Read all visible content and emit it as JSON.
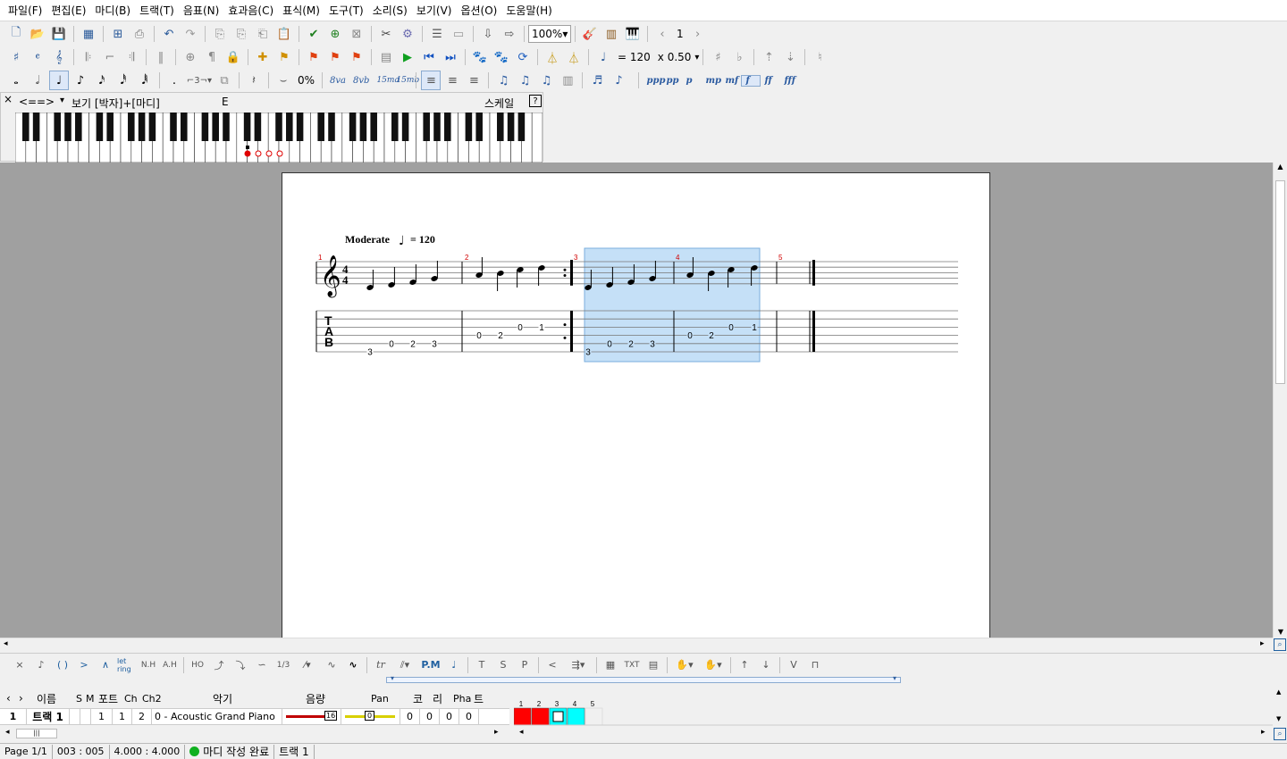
{
  "menu": [
    "파일(F)",
    "편집(E)",
    "마디(B)",
    "트랙(T)",
    "음표(N)",
    "효과음(C)",
    "표식(M)",
    "도구(T)",
    "소리(S)",
    "보기(V)",
    "옵션(O)",
    "도움말(H)"
  ],
  "toolbar": {
    "zoom": "100%",
    "page_num": "1",
    "tempo_label": "= 120",
    "speed": "x 0.50",
    "percent": "0%",
    "dynamics": [
      "ppp",
      "pp",
      "p",
      "mp",
      "mf",
      "f",
      "ff",
      "fff"
    ],
    "ottava": [
      "8va",
      "8vb",
      "15ma",
      "15mb"
    ]
  },
  "piano": {
    "nav_prev": "<=",
    "nav_next": "=>",
    "view_label": "보기 [박자]+[마디]",
    "key_label": "E",
    "scale_label": "스케일",
    "help": "?"
  },
  "score": {
    "tempo_text": "Moderate",
    "tempo_value": "= 120",
    "measure_numbers": [
      "1",
      "2",
      "3",
      "4",
      "5"
    ],
    "tab_clef": [
      "T",
      "A",
      "B"
    ],
    "tab_numbers": [
      {
        "m": 1,
        "fret": "3",
        "string": 6
      },
      {
        "m": 1,
        "fret": "0",
        "string": 5
      },
      {
        "m": 1,
        "fret": "2",
        "string": 5
      },
      {
        "m": 1,
        "fret": "3",
        "string": 5
      },
      {
        "m": 2,
        "fret": "0",
        "string": 4
      },
      {
        "m": 2,
        "fret": "2",
        "string": 4
      },
      {
        "m": 2,
        "fret": "0",
        "string": 3
      },
      {
        "m": 2,
        "fret": "1",
        "string": 3
      },
      {
        "m": 3,
        "fret": "3",
        "string": 6
      },
      {
        "m": 3,
        "fret": "0",
        "string": 5
      },
      {
        "m": 3,
        "fret": "2",
        "string": 5
      },
      {
        "m": 3,
        "fret": "3",
        "string": 5
      },
      {
        "m": 4,
        "fret": "0",
        "string": 4
      },
      {
        "m": 4,
        "fret": "2",
        "string": 4
      },
      {
        "m": 4,
        "fret": "0",
        "string": 3
      },
      {
        "m": 4,
        "fret": "1",
        "string": 3
      }
    ]
  },
  "tracks": {
    "headers": {
      "name": "이름",
      "s": "S",
      "m": "M",
      "port": "포트",
      "ch": "Ch",
      "ch2": "Ch2",
      "instrument": "악기",
      "volume": "음량",
      "pan": "Pan",
      "chorus": "코",
      "reverb": "리",
      "phaser": "Pha",
      "tremolo": "트"
    },
    "rows": [
      {
        "num": "1",
        "name": "트랙 1",
        "port": "1",
        "ch": "1",
        "ch2": "2",
        "instrument": "0 - Acoustic Grand Piano",
        "volume": "16",
        "pan": "0",
        "chorus": "0",
        "reverb": "0",
        "phaser": "0",
        "tremolo": "0"
      }
    ],
    "timeline_numbers": [
      "1",
      "2",
      "3",
      "4",
      "5"
    ]
  },
  "status": {
    "page": "Page 1/1",
    "position": "003 : 005",
    "time_sig": "4.000 : 4.000",
    "state": "마디 작성 완료",
    "track": "트랙 1"
  },
  "effects_labels": {
    "pm": "P.M",
    "txt": "TXT",
    "t": "T",
    "s": "S",
    "p": "P",
    "tr": "tr",
    "let_ring": "let ring",
    "nh": "N.H",
    "ah": "A.H",
    "ho": "HO",
    "frac": "1/3"
  },
  "colors": {
    "selection": "#c5e0f7",
    "selection_border": "#7aaedc",
    "measure_num": "#d00000",
    "filled_block": "#ff0000",
    "current_block": "#00ffff"
  }
}
